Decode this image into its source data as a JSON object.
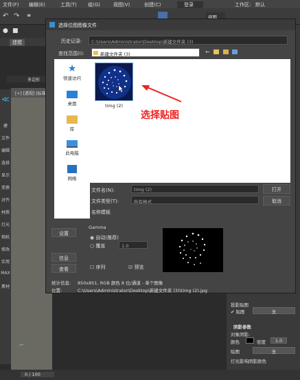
{
  "menu": {
    "file": "文件(F)",
    "edit": "编辑(E)",
    "tools": "工具(T)",
    "group": "组(G)",
    "view": "视图(V)",
    "create": "创建(C)",
    "user_field": "登录",
    "workspace": "工作区:",
    "workspace_value": "默认"
  },
  "toolbar": {
    "view_dropdown": "视图"
  },
  "left_panel": {
    "tab1": "建模",
    "viewport_label": "[+] [透视] [标准]",
    "polygon_label": "多边形",
    "side_items": [
      "建",
      "文件",
      "编辑",
      "选择",
      "显示",
      "变换",
      "对齐",
      "材质",
      "灯光",
      "相机",
      "修改",
      "实用",
      "MAX",
      "素材"
    ]
  },
  "dialog": {
    "title": "选择位图图像文件",
    "history_label": "历史记录:",
    "history_value": "C:\\Users\\Administrator\\Desktop\\新建文件夹 (3)",
    "lookin_label": "查找范围(I):",
    "lookin_value": "新建文件夹 (3)",
    "places": [
      {
        "label": "快速访问",
        "icon": "star-icon"
      },
      {
        "label": "桌面",
        "icon": "desktop-icon"
      },
      {
        "label": "库",
        "icon": "library-icon"
      },
      {
        "label": "此电脑",
        "icon": "computer-icon"
      },
      {
        "label": "网络",
        "icon": "network-icon"
      }
    ],
    "file_item": "timg (2)",
    "filename_label": "文件名(N):",
    "filename_value": "timg (2)",
    "filetype_label": "文件类型(T):",
    "filetype_value": "所有格式",
    "template_label": "名称模板",
    "buttons": {
      "setup": "设置",
      "info": "信息",
      "view": "查看",
      "open": "打开",
      "cancel": "取消"
    },
    "gamma_label": "Gamma",
    "gamma_auto": "自动(推荐)",
    "gamma_override": "覆盖",
    "gamma_value": "1.0",
    "sequence_label": "序列",
    "preview_label": "预览",
    "stats_label": "统计信息:",
    "stats_value": "850x851, RGB 颜色 8 位/通道 - 单个图像",
    "location_label": "位置:",
    "location_value": "C:\\Users\\Administrator\\Desktop\\新建文件夹 (3)\\timg (2).jpg"
  },
  "annotation": "选择贴图",
  "right_panel": {
    "shadow_map_label": "投影贴图",
    "map_label": "贴图",
    "none1": "无",
    "shadow_params": "阴影参数",
    "object_shadow": "对象阴影:",
    "color_label": "颜色",
    "density_label": "密度",
    "density_value": "1.0",
    "map2_label": "贴图",
    "none2": "无",
    "light_affects": "灯光影响阴影颜色"
  },
  "timeline": {
    "frames": "0 / 100"
  },
  "colors": {
    "accent": "#ee2222",
    "dialog_bg": "#444444",
    "panel_bg": "#3a3a3a"
  }
}
